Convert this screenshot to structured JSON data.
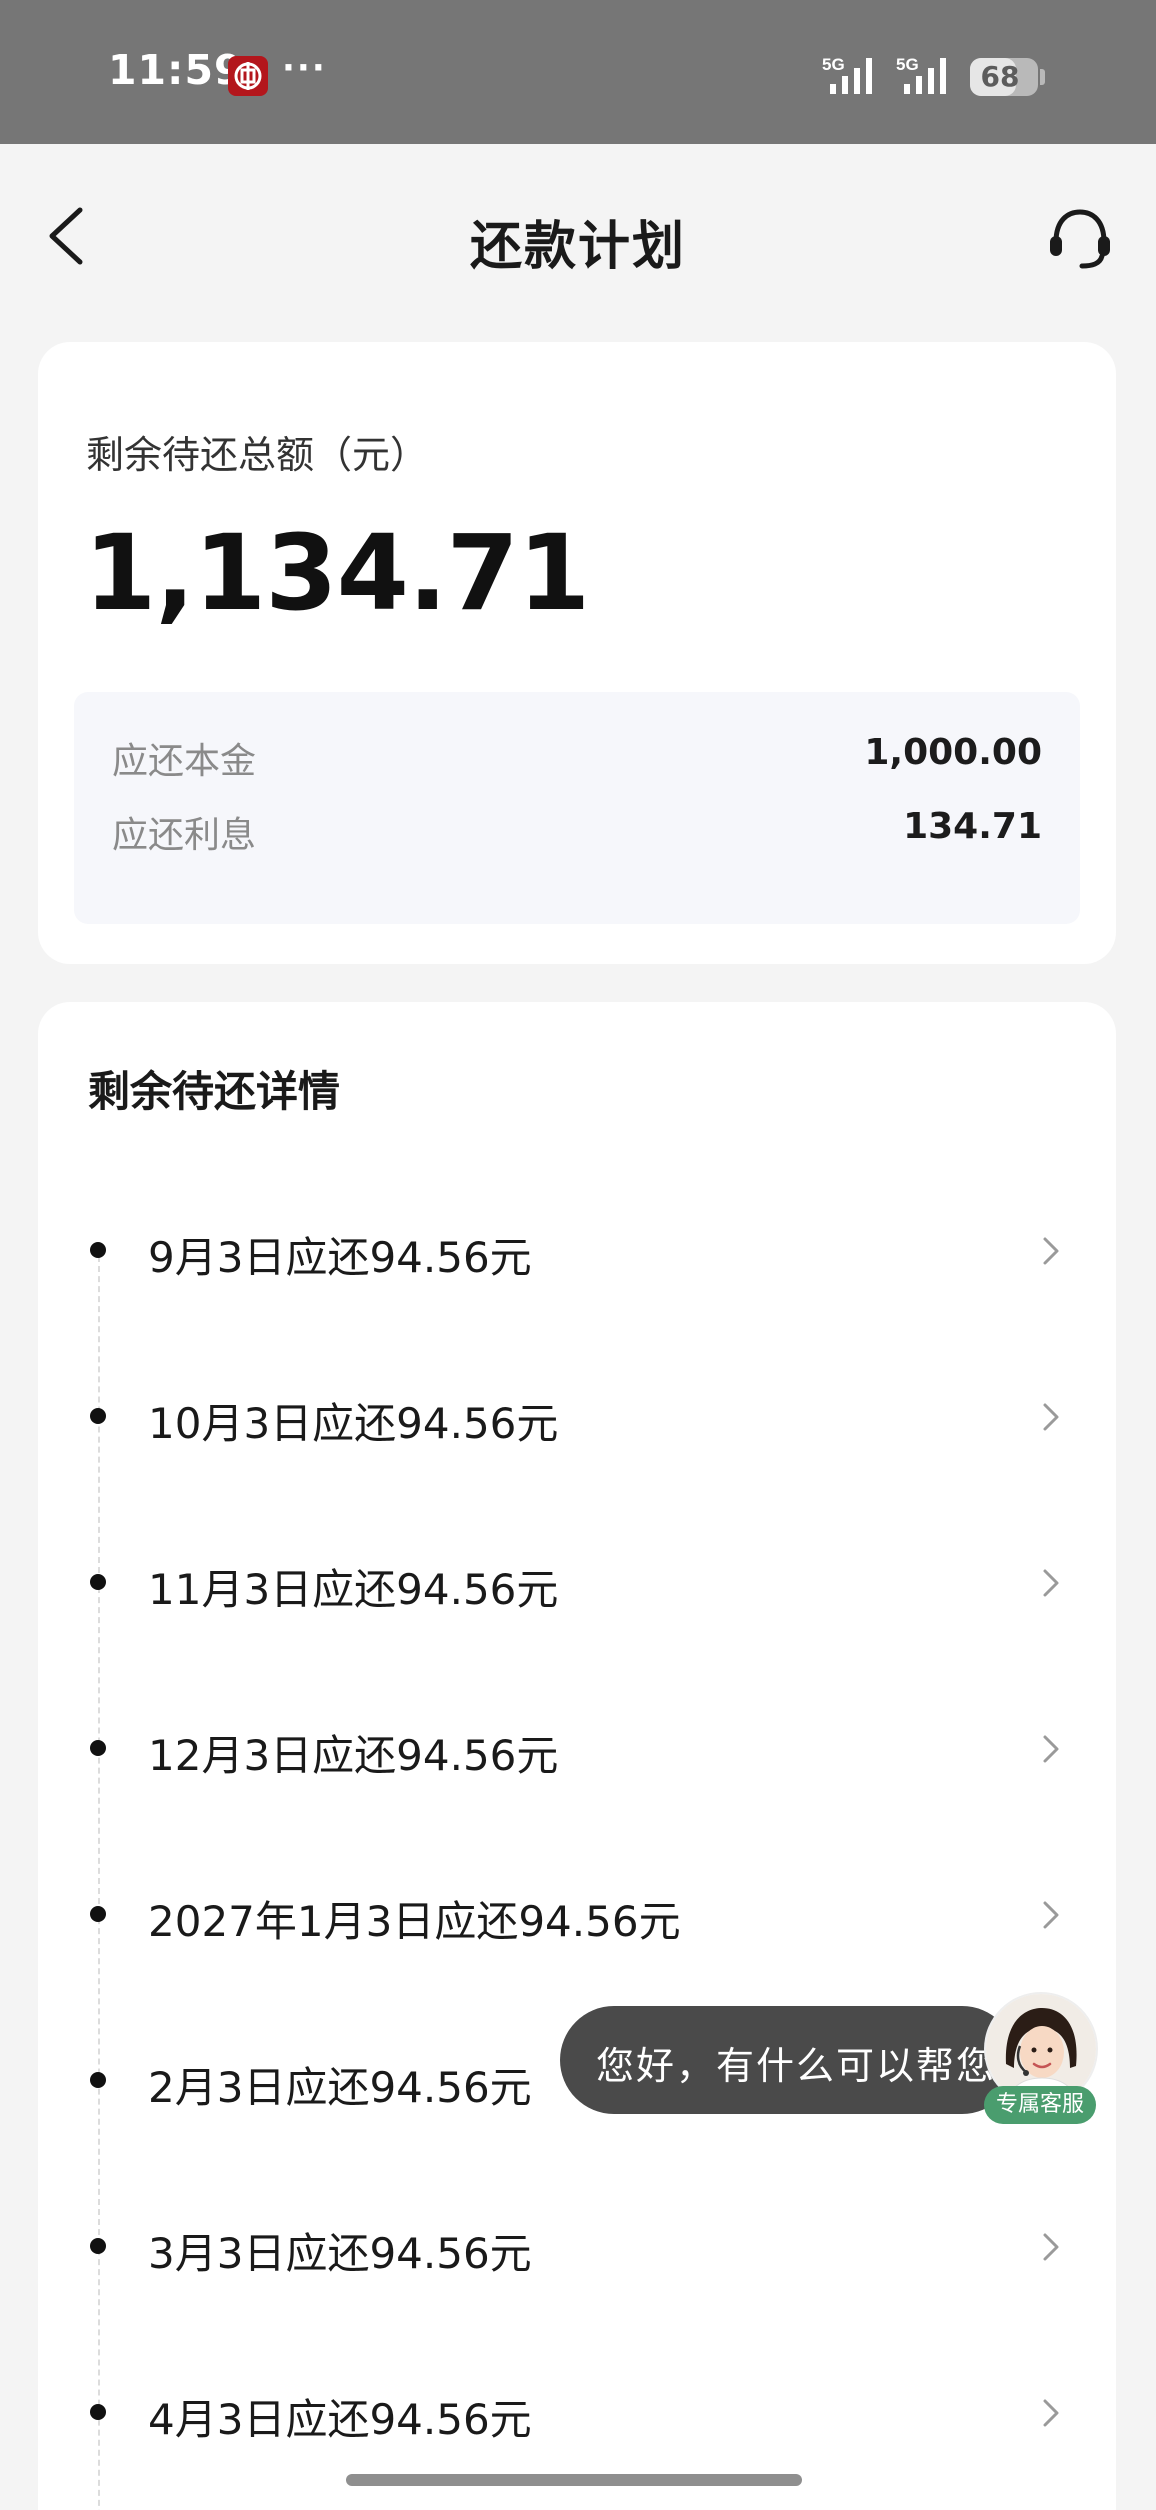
{
  "status_bar": {
    "time": "11:59",
    "more": "···",
    "network_1": "5G",
    "network_2": "5G",
    "battery": "68",
    "battery_level": 0.68
  },
  "nav": {
    "title": "还款计划"
  },
  "summary": {
    "label": "剩余待还总额（元）",
    "amount": "1,134.71",
    "principal_label": "应还本金",
    "principal_value": "1,000.00",
    "interest_label": "应还利息",
    "interest_value": "134.71"
  },
  "details": {
    "title": "剩余待还详情",
    "items": [
      {
        "label": "9月3日应还94.56元"
      },
      {
        "label": "10月3日应还94.56元"
      },
      {
        "label": "11月3日应还94.56元"
      },
      {
        "label": "12月3日应还94.56元"
      },
      {
        "label": "2027年1月3日应还94.56元"
      },
      {
        "label": "2月3日应还94.56元"
      },
      {
        "label": "3月3日应还94.56元"
      },
      {
        "label": "4月3日应还94.56元"
      }
    ]
  },
  "chat": {
    "greeting": "您好，有什么可以帮您",
    "badge": "专属客服"
  },
  "colors": {
    "status_bar": "#767676",
    "background": "#f4f4f4",
    "card": "#ffffff",
    "breakdown_bg": "#f6f7fb",
    "chat_bubble": "#4a4a4a",
    "badge_green": "#4a9d6e",
    "bank_red": "#b3161c"
  }
}
